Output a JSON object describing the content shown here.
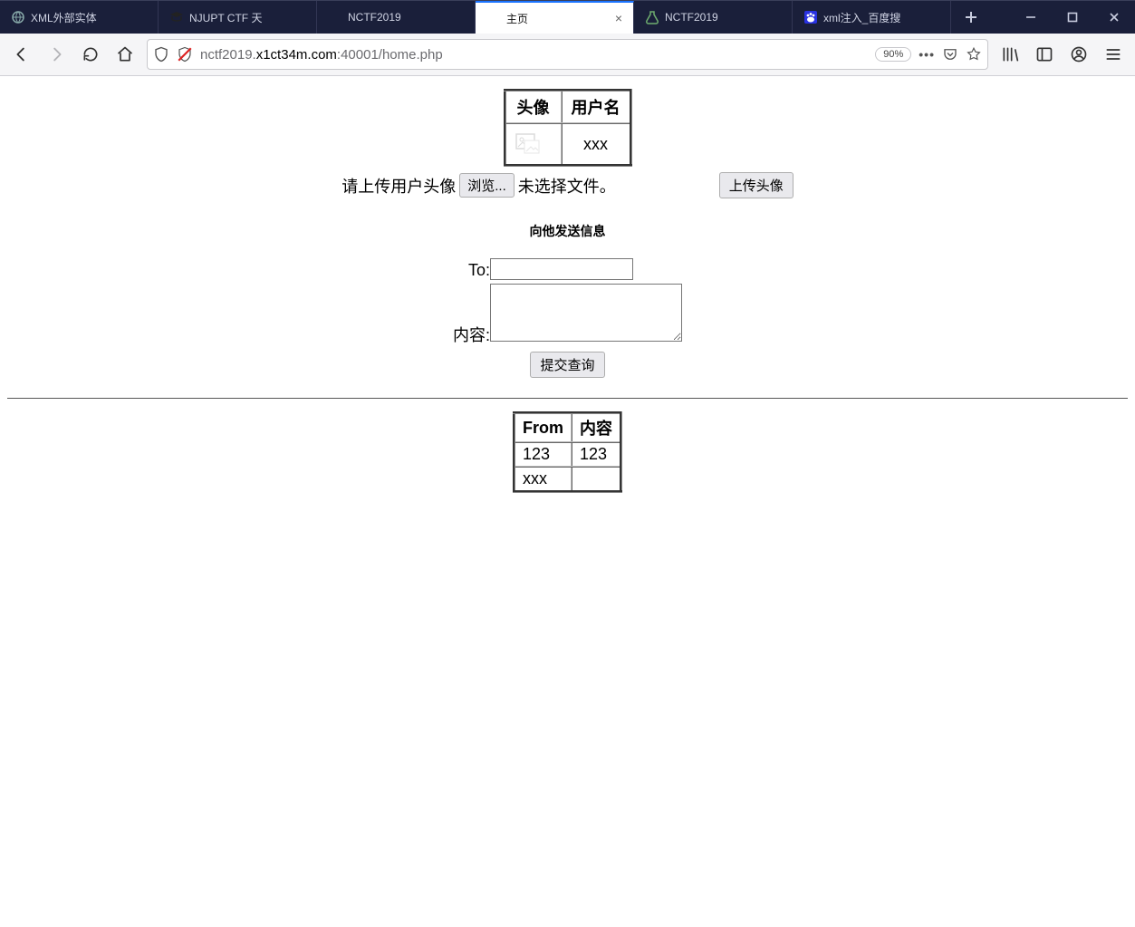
{
  "tabs": [
    {
      "label": "XML外部实体",
      "icon": "site"
    },
    {
      "label": "NJUPT CTF 天",
      "icon": "edu"
    },
    {
      "label": "NCTF2019",
      "icon": "blank"
    },
    {
      "label": "主页",
      "icon": "blank",
      "active": true
    },
    {
      "label": "NCTF2019",
      "icon": "flask"
    },
    {
      "label": "xml注入_百度搜",
      "icon": "baidu"
    }
  ],
  "toolbar": {
    "url_prefix": "nctf2019.",
    "url_host": "x1ct34m.com",
    "url_suffix": ":40001/home.php",
    "zoom": "90%"
  },
  "profile": {
    "avatar_header": "头像",
    "username_header": "用户名",
    "username": "xxx",
    "upload_prompt": "请上传用户头像",
    "browse_btn": "浏览...",
    "no_file": "未选择文件。",
    "upload_btn": "上传头像"
  },
  "sendbox": {
    "title": "向他发送信息",
    "to_label": "To:",
    "content_label": "内容:",
    "submit": "提交查询"
  },
  "messages": {
    "from_header": "From",
    "content_header": "内容",
    "rows": [
      {
        "from": "123",
        "content": "123"
      },
      {
        "from": "xxx",
        "content": ""
      }
    ]
  }
}
